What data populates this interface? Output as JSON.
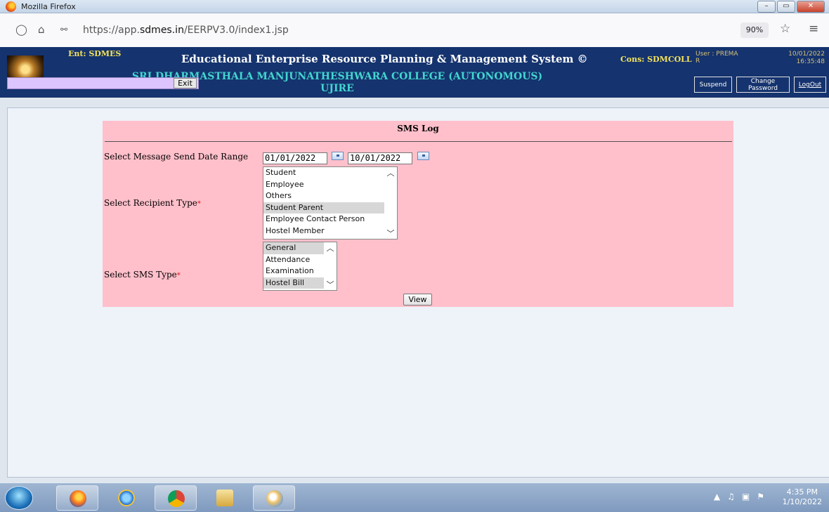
{
  "window": {
    "title": "Mozilla Firefox",
    "controls": {
      "minimize": "–",
      "maximize": "▭",
      "close": "✕"
    }
  },
  "browser": {
    "url_prefix": "https://app.",
    "url_domain": "sdmes.in",
    "url_path": "/EERPV3.0/index1.jsp",
    "zoom": "90%"
  },
  "header": {
    "ent": "Ent: SDMES",
    "system_title": "Educational Enterprise Resource Planning & Management System ©",
    "cons": "Cons: SDMCOLL",
    "user_line1": "User : PREMA",
    "user_line2": "R",
    "date": "10/01/2022",
    "time": "16:35:48",
    "college_line1": "SRI DHARMASTHALA MANJUNATHESHWARA COLLEGE (AUTONOMOUS)",
    "college_line2": "UJIRE",
    "exit_label": "Exit",
    "suspend_label": "Suspend",
    "change_password_line1": "Change",
    "change_password_line2": "Password",
    "logout_label": "LogOut"
  },
  "form": {
    "title": "SMS Log",
    "date_range_label": "Select Message Send Date Range",
    "from_date": "01/01/2022",
    "to_date": "10/01/2022",
    "recipient_label": "Select Recipient Type",
    "recipient_options": [
      {
        "label": "Student",
        "selected": false
      },
      {
        "label": "Employee",
        "selected": false
      },
      {
        "label": "Others",
        "selected": false
      },
      {
        "label": "Student Parent",
        "selected": true
      },
      {
        "label": "Employee Contact Person",
        "selected": false
      },
      {
        "label": "Hostel Member",
        "selected": false
      }
    ],
    "sms_type_label": "Select SMS Type",
    "sms_type_options": [
      {
        "label": "General",
        "selected": true
      },
      {
        "label": "Attendance",
        "selected": false
      },
      {
        "label": "Examination",
        "selected": false
      },
      {
        "label": "Hostel Bill",
        "selected": true
      }
    ],
    "required_marker": "*",
    "view_label": "View"
  },
  "taskbar": {
    "time": "4:35 PM",
    "date": "1/10/2022"
  }
}
